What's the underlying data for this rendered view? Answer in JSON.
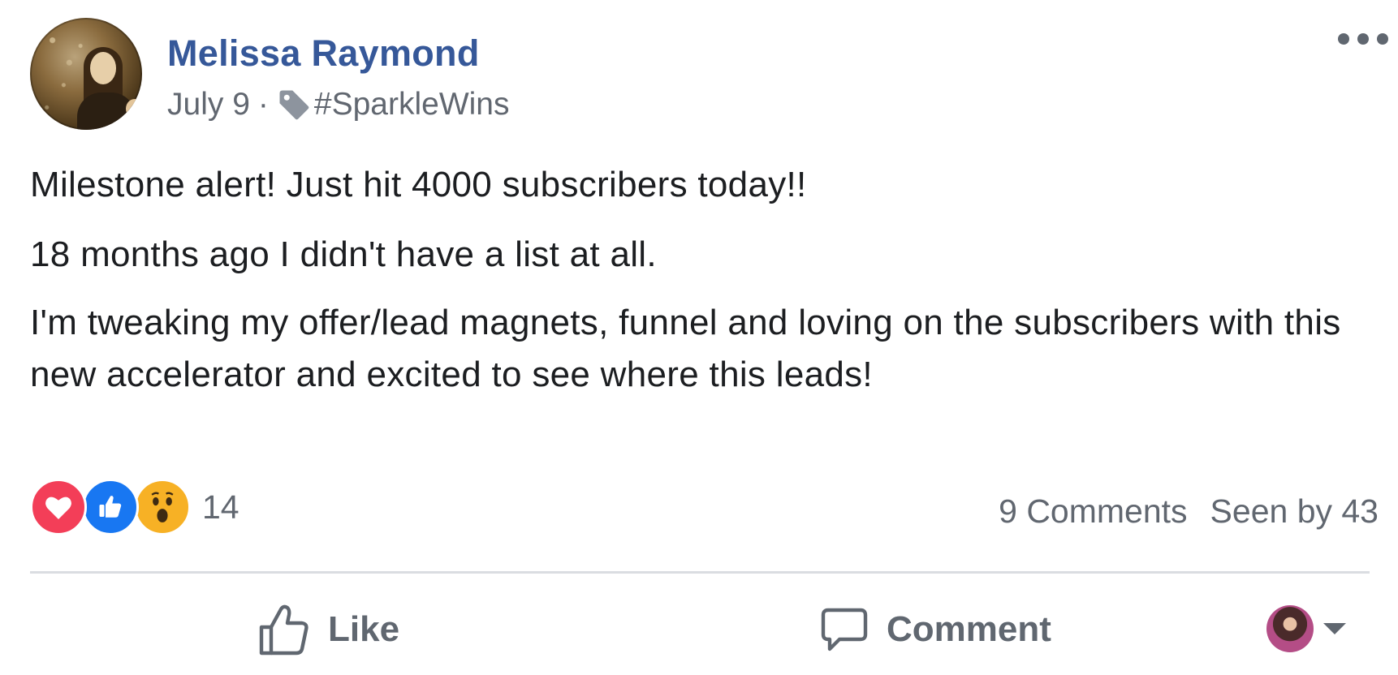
{
  "post": {
    "author": "Melissa Raymond",
    "date": "July 9",
    "separator": "·",
    "tag": "#SparkleWins",
    "paragraphs": [
      "Milestone alert! Just hit 4000 subscribers today!!",
      "18 months ago I didn't have a list at all.",
      "I'm tweaking my offer/lead magnets, funnel and loving on the subscribers with this new accelerator and excited to see where this leads!"
    ]
  },
  "reactions": {
    "types": [
      "love",
      "like",
      "wow"
    ],
    "count": "14",
    "colors": {
      "love": "#f33e58",
      "like": "#1877f2",
      "wow": "#f7b125"
    }
  },
  "stats": {
    "comments": "9 Comments",
    "seen_by": "Seen by 43"
  },
  "actions": {
    "like_label": "Like",
    "comment_label": "Comment"
  },
  "icons": {
    "more": "more-options-icon",
    "tag": "tag-icon",
    "like": "thumbs-up-icon",
    "comment": "speech-bubble-icon",
    "caret": "chevron-down-icon"
  },
  "theme": {
    "name_color": "#365899",
    "meta_color": "#616770",
    "text_color": "#1c1e21"
  }
}
